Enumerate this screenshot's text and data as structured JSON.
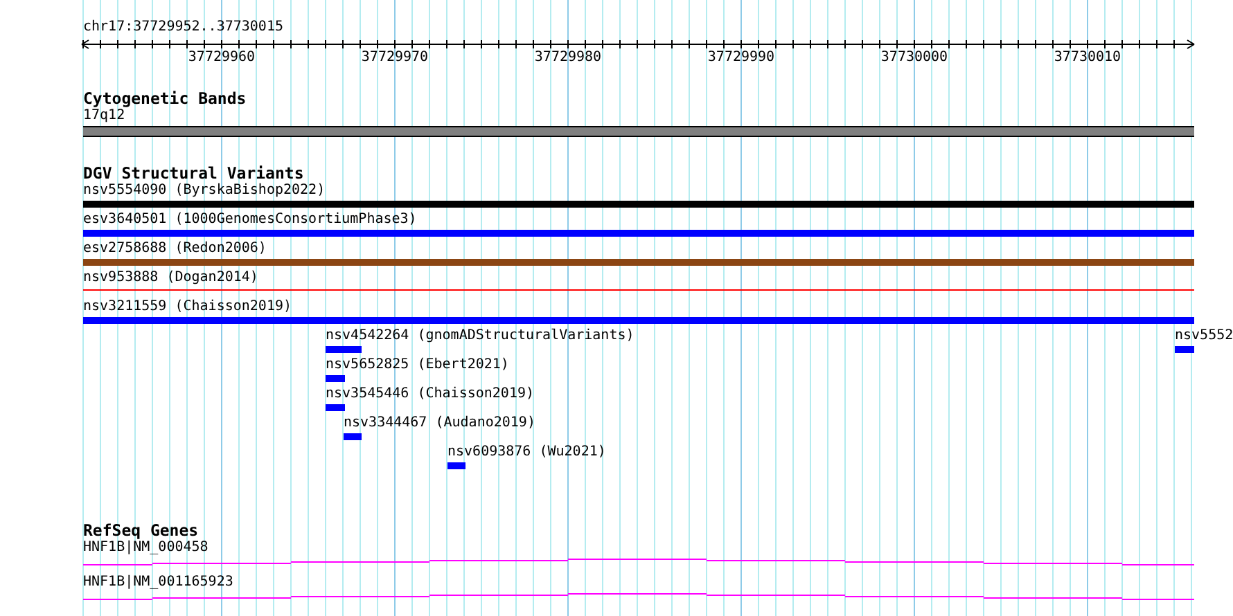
{
  "ruler": {
    "location": "chr17:37729952..37730015",
    "labels": [
      "37729960",
      "37729970",
      "37729980",
      "37729990",
      "37730000",
      "37730010"
    ]
  },
  "cytogenetic_bands": {
    "title": "Cytogenetic Bands",
    "features": [
      {
        "label": "17q12"
      }
    ]
  },
  "dgv_structural_variants": {
    "title": "DGV Structural Variants",
    "features": [
      {
        "label": "nsv5554090 (ByrskaBishop2022)",
        "kind": "bar",
        "color": "#000000"
      },
      {
        "label": "esv3640501 (1000GenomesConsortiumPhase3)",
        "kind": "bar",
        "color": "#0000ff"
      },
      {
        "label": "esv2758688 (Redon2006)",
        "kind": "bar",
        "color": "#8b4513"
      },
      {
        "label": "nsv953888 (Dogan2014)",
        "kind": "line",
        "color": "#ff0000"
      },
      {
        "label": "nsv3211559 (Chaisson2019)",
        "kind": "bar",
        "color": "#0000ff"
      },
      {
        "label": "nsv4542264 (gnomADStructuralVariants)",
        "kind": "bar",
        "color": "#0000ff"
      },
      {
        "label": "nsv5552",
        "kind": "bar",
        "color": "#0000ff"
      },
      {
        "label": "nsv5652825 (Ebert2021)",
        "kind": "bar",
        "color": "#0000ff"
      },
      {
        "label": "nsv3545446 (Chaisson2019)",
        "kind": "bar",
        "color": "#0000ff"
      },
      {
        "label": "nsv3344467 (Audano2019)",
        "kind": "bar",
        "color": "#0000ff"
      },
      {
        "label": "nsv6093876 (Wu2021)",
        "kind": "bar",
        "color": "#0000ff"
      }
    ]
  },
  "refseq_genes": {
    "title": "RefSeq Genes",
    "features": [
      {
        "label": "HNF1B|NM_000458"
      },
      {
        "label": "HNF1B|NM_001165923"
      }
    ]
  }
}
